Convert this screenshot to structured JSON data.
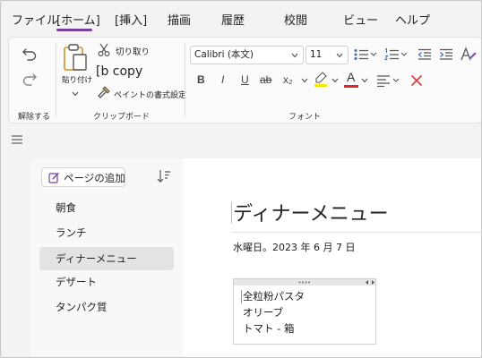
{
  "menu": {
    "file": "ファイル",
    "home": "[ホーム]",
    "insert": "[挿入]",
    "draw": "描画",
    "history": "履歴",
    "review": "校閲",
    "view": "ビュー",
    "help": "ヘルプ"
  },
  "ribbon": {
    "undo_group_label": "解除する",
    "paste_label": "貼り付け",
    "cut_label": "切り取り",
    "copy_label": "[b copy",
    "format_painter_label": "ペイントの書式設定",
    "clipboard_group_label": "クリップボード",
    "font_name": "Calibri (本文)",
    "font_size": "11",
    "font_group_label": "フォント",
    "bold": "B",
    "italic": "I",
    "underline": "U",
    "strike": "ab",
    "subscript": "x₂",
    "font_color_letter": "A"
  },
  "colors": {
    "accent": "#7b3fa0",
    "highlight": "#f6e600",
    "font_color": "#e0262b",
    "clear_format": "#d83b3b",
    "paste_icon": "#d99a3a"
  },
  "sidebar": {
    "add_page_label": "ページの追加",
    "pages": [
      {
        "label": "朝食"
      },
      {
        "label": "ランチ"
      },
      {
        "label": "ディナーメニュー"
      },
      {
        "label": "デザート"
      },
      {
        "label": "タンパク質"
      }
    ],
    "selected_index": 2
  },
  "note": {
    "title": "ディナーメニュー",
    "date": "水曜日。2023 年 6 月 7 日",
    "lines": [
      "全粒粉パスタ",
      "オリーブ",
      "トマト - 箱"
    ]
  }
}
